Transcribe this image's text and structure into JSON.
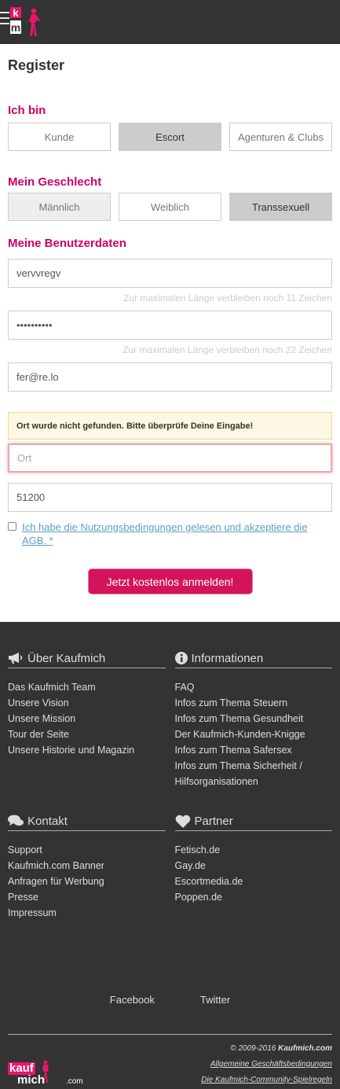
{
  "header": {
    "menu_icon": "hamburger-icon",
    "logo_letters": [
      "k",
      "m"
    ],
    "accent_color": "#e6176d"
  },
  "page": {
    "title": "Register"
  },
  "ich_bin": {
    "label": "Ich bin",
    "options": [
      "Kunde",
      "Escort",
      "Agenturen & Clubs"
    ],
    "selected": "Escort"
  },
  "geschlecht": {
    "label": "Mein Geschlecht",
    "options": [
      "Männlich",
      "Weiblich",
      "Transsexuell"
    ],
    "selected": "Transsexuell"
  },
  "benutzerdaten": {
    "label": "Meine Benutzerdaten",
    "username_value": "vervvregv",
    "username_hint": "Zur maximalen Länge verbleiben noch 11 Zeichen",
    "password_value": "••••••••••",
    "password_hint": "Zur maximalen Länge verbleiben noch 22 Zeichen",
    "email_value": "fer@re.lo",
    "error_message": "Ort wurde nicht gefunden. Bitte überprüfe Deine Eingabe!",
    "ort_placeholder": "Ort",
    "plz_value": "51200",
    "agb_text": "Ich habe die Nutzungsbedingungen gelesen und akzeptiere die AGB. *",
    "submit_label": "Jetzt kostenlos anmelden!"
  },
  "footer": {
    "about": {
      "heading": "Über Kaufmich",
      "icon": "megaphone-icon",
      "links": [
        "Das Kaufmich Team",
        "Unsere Vision",
        "Unsere Mission",
        "Tour der Seite",
        "Unsere Historie und Magazin"
      ]
    },
    "info": {
      "heading": "Informationen",
      "icon": "info-icon",
      "links": [
        "FAQ",
        "Infos zum Thema Steuern",
        "Infos zum Thema Gesundheit",
        "Der Kaufmich-Kunden-Knigge",
        "Infos zum Thema Safersex",
        "Infos zum Thema Sicherheit /",
        "Hilfsorganisationen"
      ]
    },
    "contact": {
      "heading": "Kontakt",
      "icon": "chat-bubbles-icon",
      "links": [
        "Support",
        "Kaufmich.com Banner",
        "Anfragen für Werbung",
        "Presse",
        "Impressum"
      ]
    },
    "partner": {
      "heading": "Partner",
      "icon": "heart-icon",
      "links": [
        "Fetisch.de",
        "Gay.de",
        "Escortmedia.de",
        "Poppen.de"
      ]
    },
    "social": [
      "Facebook",
      "Twitter"
    ],
    "copyright_prefix": "© 2009-2016 ",
    "copyright_brand": "Kaufmich.com",
    "legal_links": [
      "Allgemeine Geschäftsbedingungen",
      "Die Kaufmich-Community-Spielregeln"
    ],
    "logo_text": {
      "top": "kauf",
      "bottom": "mich",
      "suffix": ".com"
    }
  }
}
